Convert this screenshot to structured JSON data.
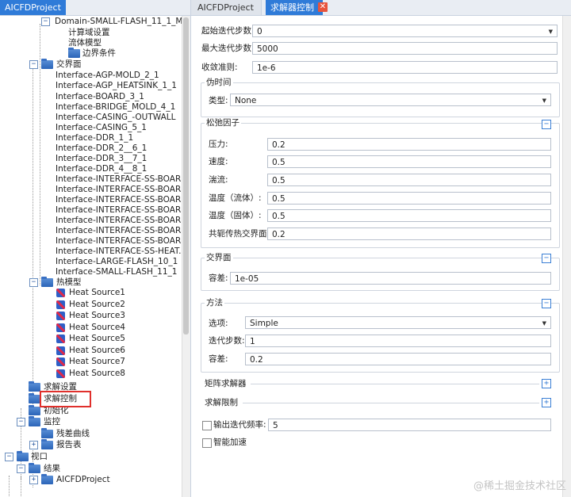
{
  "left_panel": {
    "tab_label": "AICFDProject",
    "tree": [
      {
        "text": "Domain-SMALL-FLASH_11_1_M...",
        "kind": "toggle-minus"
      },
      {
        "text": "计算域设置",
        "kind": "text"
      },
      {
        "text": "流体模型",
        "kind": "text"
      },
      {
        "text": "边界条件",
        "kind": "folder"
      },
      {
        "text": "交界面",
        "kind": "folder-minus"
      },
      {
        "text": "Interface-AGP-MOLD_2_1",
        "kind": "text"
      },
      {
        "text": "Interface-AGP_HEATSINK_1_1",
        "kind": "text"
      },
      {
        "text": "Interface-BOARD_3_1",
        "kind": "text"
      },
      {
        "text": "Interface-BRIDGE_MOLD_4_1",
        "kind": "text"
      },
      {
        "text": "Interface-CASING_-OUTWALL",
        "kind": "text"
      },
      {
        "text": "Interface-CASING_5_1",
        "kind": "text"
      },
      {
        "text": "Interface-DDR_1_1",
        "kind": "text"
      },
      {
        "text": "Interface-DDR_2__6_1",
        "kind": "text"
      },
      {
        "text": "Interface-DDR_3__7_1",
        "kind": "text"
      },
      {
        "text": "Interface-DDR_4__8_1",
        "kind": "text"
      },
      {
        "text": "Interface-INTERFACE-SS-BOAR...",
        "kind": "text"
      },
      {
        "text": "Interface-INTERFACE-SS-BOAR...",
        "kind": "text"
      },
      {
        "text": "Interface-INTERFACE-SS-BOAR...",
        "kind": "text"
      },
      {
        "text": "Interface-INTERFACE-SS-BOAR...",
        "kind": "text"
      },
      {
        "text": "Interface-INTERFACE-SS-BOAR...",
        "kind": "text"
      },
      {
        "text": "Interface-INTERFACE-SS-BOAR...",
        "kind": "text"
      },
      {
        "text": "Interface-INTERFACE-SS-BOAR...",
        "kind": "text"
      },
      {
        "text": "Interface-INTERFACE-SS-HEAT...",
        "kind": "text"
      },
      {
        "text": "Interface-LARGE-FLASH_10_1",
        "kind": "text"
      },
      {
        "text": "Interface-SMALL-FLASH_11_1",
        "kind": "text"
      },
      {
        "text": "热模型",
        "kind": "folder-minus"
      },
      {
        "text": "Heat Source1",
        "kind": "heat"
      },
      {
        "text": "Heat Source2",
        "kind": "heat"
      },
      {
        "text": "Heat Source3",
        "kind": "heat"
      },
      {
        "text": "Heat Source4",
        "kind": "heat"
      },
      {
        "text": "Heat Source5",
        "kind": "heat"
      },
      {
        "text": "Heat Source6",
        "kind": "heat"
      },
      {
        "text": "Heat Source7",
        "kind": "heat"
      },
      {
        "text": "Heat Source8",
        "kind": "heat"
      },
      {
        "text": "求解设置",
        "kind": "folder"
      },
      {
        "text": "求解控制",
        "kind": "folder"
      },
      {
        "text": "初始化",
        "kind": "folder"
      },
      {
        "text": "监控",
        "kind": "folder-minus"
      },
      {
        "text": "残差曲线",
        "kind": "folder"
      },
      {
        "text": "报告表",
        "kind": "folder-plus"
      },
      {
        "text": "视口",
        "kind": "folder-minus"
      },
      {
        "text": "结果",
        "kind": "folder-minus"
      },
      {
        "text": "AICFDProject",
        "kind": "folder-plus"
      }
    ]
  },
  "right_panel": {
    "tab_inactive": "AICFDProject",
    "tab_active": "求解器控制",
    "close_glyph": "✕",
    "start_iter": {
      "label": "起始迭代步数:",
      "value": "0"
    },
    "max_iter": {
      "label": "最大迭代步数:",
      "value": "5000"
    },
    "convergence": {
      "label": "收敛准则:",
      "value": "1e-6"
    },
    "pseudo_time": {
      "title": "伪时间",
      "type_label": "类型:",
      "type_value": "None"
    },
    "relaxation": {
      "title": "松弛因子",
      "fields": [
        {
          "label": "压力:",
          "value": "0.2"
        },
        {
          "label": "速度:",
          "value": "0.5"
        },
        {
          "label": "湍流:",
          "value": "0.5"
        },
        {
          "label": "温度（流体）:",
          "value": "0.5"
        },
        {
          "label": "温度（固体）:",
          "value": "0.5"
        },
        {
          "label": "共轭传热交界面:",
          "value": "0.2"
        }
      ]
    },
    "interface": {
      "title": "交界面",
      "tol_label": "容差:",
      "tol_value": "1e-05"
    },
    "method": {
      "title": "方法",
      "option_label": "选项:",
      "option_value": "Simple",
      "iter_label": "迭代步数:",
      "iter_value": "1",
      "tol_label": "容差:",
      "tol_value": "0.2"
    },
    "matrix_solver": {
      "title": "矩阵求解器"
    },
    "solve_limit": {
      "title": "求解限制"
    },
    "output_freq": {
      "label": "输出迭代频率:",
      "value": "5"
    },
    "smart_accel": {
      "label": "智能加速"
    }
  },
  "watermark": "@稀土掘金技术社区",
  "colors": {
    "accent": "#2f7bd8",
    "highlight": "#e0302c",
    "close": "#e8543c"
  }
}
